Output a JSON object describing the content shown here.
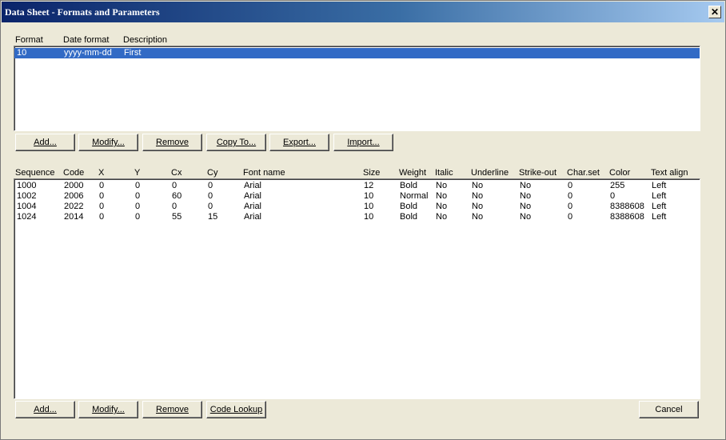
{
  "window": {
    "title": "Data Sheet - Formats and Parameters",
    "close_label": "✕"
  },
  "formats": {
    "columns": [
      "Format",
      "Date format",
      "Description"
    ],
    "rows": [
      {
        "format": "10",
        "date_format": "yyyy-mm-dd",
        "description": "First",
        "selected": true
      }
    ],
    "buttons": [
      "Add...",
      "Modify...",
      "Remove",
      "Copy To...",
      "Export...",
      "Import..."
    ]
  },
  "parameters": {
    "columns": [
      "Sequence",
      "Code",
      "X",
      "Y",
      "Cx",
      "Cy",
      "Font name",
      "Size",
      "Weight",
      "Italic",
      "Underline",
      "Strike-out",
      "Char.set",
      "Color",
      "Text align"
    ],
    "rows": [
      [
        "1000",
        "2000",
        "0",
        "0",
        "0",
        "0",
        "Arial",
        "12",
        "Bold",
        "No",
        "No",
        "No",
        "0",
        "255",
        "Left"
      ],
      [
        "1002",
        "2006",
        "0",
        "0",
        "60",
        "0",
        "Arial",
        "10",
        "Normal",
        "No",
        "No",
        "No",
        "0",
        "0",
        "Left"
      ],
      [
        "1004",
        "2022",
        "0",
        "0",
        "0",
        "0",
        "Arial",
        "10",
        "Bold",
        "No",
        "No",
        "No",
        "0",
        "8388608",
        "Left"
      ],
      [
        "1024",
        "2014",
        "0",
        "0",
        "55",
        "15",
        "Arial",
        "10",
        "Bold",
        "No",
        "No",
        "No",
        "0",
        "8388608",
        "Left"
      ]
    ],
    "buttons": [
      "Add...",
      "Modify...",
      "Remove",
      "Code Lookup"
    ]
  },
  "cancel_label": "Cancel",
  "colors": {
    "title_start": "#0a246a",
    "title_end": "#a6caf0",
    "selection": "#316ac5",
    "face": "#ece9d8"
  }
}
